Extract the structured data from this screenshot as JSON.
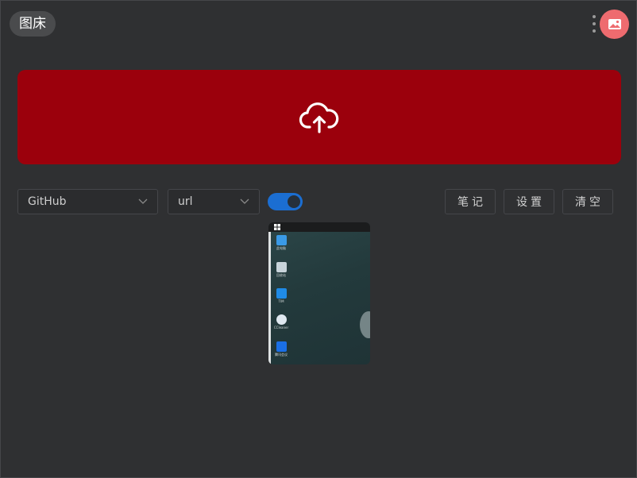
{
  "header": {
    "app_badge": "图床",
    "more_icon": "more-vertical-icon",
    "avatar_icon": "image-icon",
    "avatar_color": "#ee6b6f"
  },
  "upload": {
    "icon": "cloud-upload-icon",
    "background_color": "#9b000c"
  },
  "toolbar": {
    "repo_select": {
      "value": "GitHub",
      "icon": "chevron-down-icon"
    },
    "format_select": {
      "value": "url",
      "icon": "chevron-down-icon"
    },
    "toggle": {
      "on": true,
      "color": "#1b6ed2"
    },
    "notes_label": "笔记",
    "settings_label": "设置",
    "clear_label": "清空"
  },
  "gallery": {
    "images": [
      {
        "kind": "desktop-screenshot",
        "desktop_icons": [
          {
            "caption": "此电脑",
            "icon": "computer-icon",
            "color": "#3a9ae6"
          },
          {
            "caption": "回收站",
            "icon": "recycle-bin-icon",
            "color": "#c8d4da"
          },
          {
            "caption": "TIM",
            "icon": "tim-icon",
            "color": "#1f8be6"
          },
          {
            "caption": "CCleaner",
            "icon": "ccleaner-icon",
            "color": "#dfe8f0"
          },
          {
            "caption": "腾讯会议",
            "icon": "meeting-icon",
            "color": "#1a6fe6"
          }
        ]
      }
    ]
  }
}
